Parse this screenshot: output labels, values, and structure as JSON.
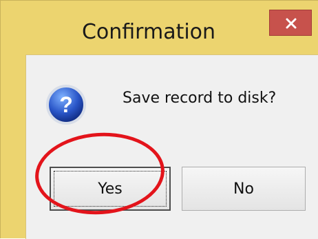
{
  "dialog": {
    "title": "Confirmation",
    "message": "Save record to disk?",
    "close_glyph": "×",
    "icon": "question-icon",
    "buttons": {
      "yes_label": "Yes",
      "no_label": "No"
    },
    "highlighted_button": "yes"
  },
  "colors": {
    "frame": "#ecd46f",
    "close_button": "#c7524c",
    "client": "#f0f0f0",
    "annotation": "#e3141b"
  }
}
